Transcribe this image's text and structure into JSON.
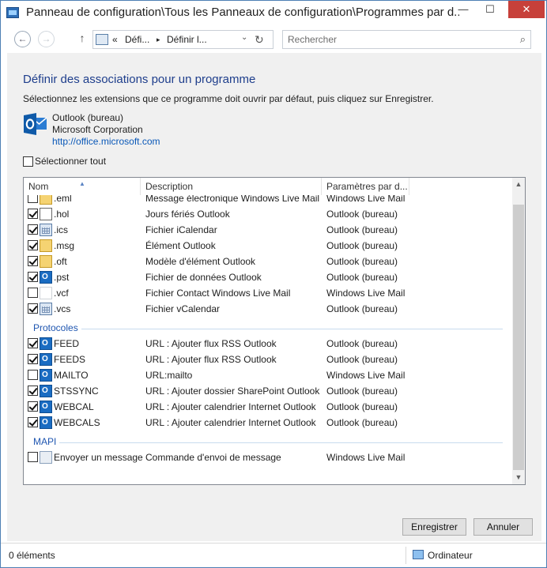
{
  "titlebar": {
    "title": "Panneau de configuration\\Tous les Panneaux de configuration\\Programmes par d...",
    "minimize": "—",
    "maximize": "☐",
    "close": "✕"
  },
  "nav": {
    "back": "←",
    "forward": "→",
    "up": "↑",
    "address": {
      "chevron": "«",
      "crumb1": "Défi...",
      "arrow": "▸",
      "crumb2": "Définir l...",
      "dropdown": "⌄",
      "refresh": "↻"
    },
    "search": {
      "placeholder": "Rechercher",
      "icon": "⌕"
    }
  },
  "main": {
    "heading": "Définir des associations pour un programme",
    "intro": "Sélectionnez les extensions que ce programme doit ouvrir par défaut, puis cliquez sur Enregistrer.",
    "app": {
      "name": "Outlook (bureau)",
      "publisher": "Microsoft Corporation",
      "link": "http://office.microsoft.com"
    },
    "select_all": "Sélectionner tout",
    "columns": {
      "name": "Nom",
      "description": "Description",
      "params": "Paramètres par d..."
    },
    "rows": [
      {
        "name": ".eml",
        "description": "Message électronique Windows Live Mail",
        "param": "Windows Live Mail",
        "checked": false,
        "icon": "envelope-icon"
      },
      {
        "name": ".hol",
        "description": "Jours fériés Outlook",
        "param": "Outlook (bureau)",
        "checked": true,
        "icon": "holiday-file-icon"
      },
      {
        "name": ".ics",
        "description": "Fichier iCalendar",
        "param": "Outlook (bureau)",
        "checked": true,
        "icon": "calendar-icon"
      },
      {
        "name": ".msg",
        "description": "Élément Outlook",
        "param": "Outlook (bureau)",
        "checked": true,
        "icon": "envelope-icon"
      },
      {
        "name": ".oft",
        "description": "Modèle d'élément Outlook",
        "param": "Outlook (bureau)",
        "checked": true,
        "icon": "envelope-icon"
      },
      {
        "name": ".pst",
        "description": "Fichier de données Outlook",
        "param": "Outlook (bureau)",
        "checked": true,
        "icon": "outlook-data-icon"
      },
      {
        "name": ".vcf",
        "description": "Fichier Contact Windows Live Mail",
        "param": "Windows Live Mail",
        "checked": false,
        "icon": "blank-file-icon"
      },
      {
        "name": ".vcs",
        "description": "Fichier vCalendar",
        "param": "Outlook (bureau)",
        "checked": true,
        "icon": "calendar-icon"
      }
    ],
    "group_protocols": "Protocoles",
    "protocols": [
      {
        "name": "FEED",
        "description": "URL : Ajouter flux RSS Outlook",
        "param": "Outlook (bureau)",
        "checked": true,
        "icon": "outlook-icon"
      },
      {
        "name": "FEEDS",
        "description": "URL : Ajouter flux RSS Outlook",
        "param": "Outlook (bureau)",
        "checked": true,
        "icon": "outlook-icon"
      },
      {
        "name": "MAILTO",
        "description": "URL:mailto",
        "param": "Windows Live Mail",
        "checked": false,
        "icon": "outlook-icon"
      },
      {
        "name": "STSSYNC",
        "description": "URL : Ajouter dossier SharePoint Outlook",
        "param": "Outlook (bureau)",
        "checked": true,
        "icon": "outlook-icon"
      },
      {
        "name": "WEBCAL",
        "description": "URL : Ajouter calendrier Internet Outlook",
        "param": "Outlook (bureau)",
        "checked": true,
        "icon": "outlook-icon"
      },
      {
        "name": "WEBCALS",
        "description": "URL : Ajouter calendrier Internet Outlook",
        "param": "Outlook (bureau)",
        "checked": true,
        "icon": "outlook-icon"
      }
    ],
    "group_mapi": "MAPI",
    "mapi": [
      {
        "name": "Envoyer un message",
        "description": "Commande d'envoi de message",
        "param": "Windows Live Mail",
        "checked": false,
        "icon": "send-message-icon"
      }
    ],
    "save_button": "Enregistrer",
    "cancel_button": "Annuler"
  },
  "status": {
    "items": "0 éléments",
    "computer": "Ordinateur"
  },
  "colors": {
    "heading": "#1e3e8c",
    "link": "#0a58b8",
    "group": "#1e55b0",
    "close": "#c7403a"
  }
}
